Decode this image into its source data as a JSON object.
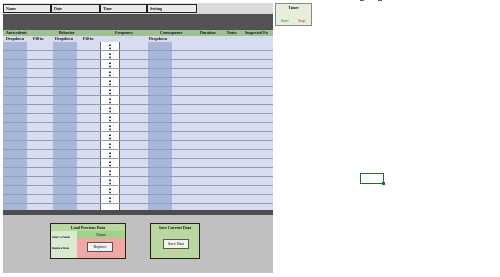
{
  "header": {
    "name_label": "Name",
    "date_label": "Date",
    "time_label": "Time",
    "setting_label": "Setting"
  },
  "columns": {
    "antecedents": "Antecedents",
    "behavior": "Behavior",
    "frequency": "Frequency",
    "consequence": "Consequence",
    "duration": "Duration",
    "notes": "Notes",
    "suspected_fn": "Suspected Fu"
  },
  "subcolumns": {
    "dropdown_1": "Dropdown",
    "fillin_1": "Fill-in",
    "dropdown_2": "Dropdown",
    "fillin_2": "Fill-in",
    "dropdown_3": "Dropdown"
  },
  "stepper": {
    "up_glyph": "▲",
    "down_glyph": "▼"
  },
  "load_panel": {
    "title": "Load Previous Data",
    "select_label": "Select a Name",
    "name_value": "Name",
    "replace_label": "Replace Data",
    "replace_button": "Replace"
  },
  "save_panel": {
    "title": "Save Current Data",
    "save_button": "Save Data"
  },
  "timer": {
    "title": "Timer",
    "start_label": "Start",
    "stop_label": "Stop",
    "start_color": "#2e7d32",
    "stop_color": "#c62828"
  },
  "colors": {
    "header_green": "#9fc18f",
    "grid_blue": "#d7ddef",
    "dropdown_col": "#a8b6d8",
    "panel_green": "#b9d79f",
    "panel_red": "#f2a7a7"
  }
}
